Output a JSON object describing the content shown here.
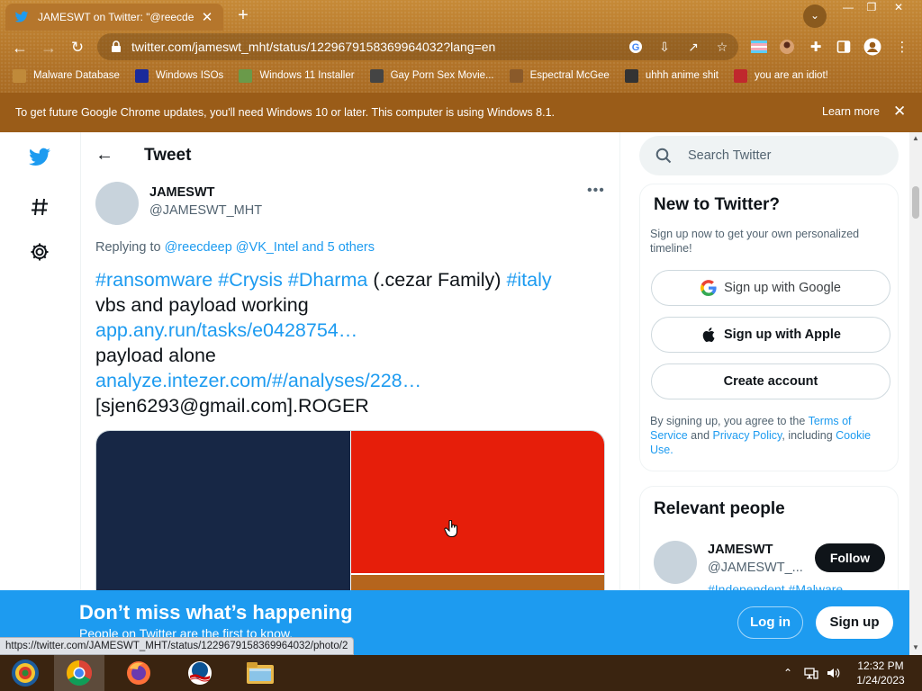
{
  "browser": {
    "tab_title": "JAMESWT on Twitter: \"@reecde",
    "new_tab": "+",
    "tab_search": "⌄",
    "window_controls": {
      "minimize": "—",
      "restore": "❐",
      "close": "✕"
    },
    "url": "twitter.com/jameswt_mht/status/1229679158369964032?lang=en",
    "bookmarks": [
      {
        "label": "Malware Database",
        "color": "#c08a3a"
      },
      {
        "label": "Windows ISOs",
        "color": "#1a2a9a"
      },
      {
        "label": "Windows 11 Installer",
        "color": "#6a9a4a"
      },
      {
        "label": "Gay Porn Sex Movie...",
        "color": "#444444"
      },
      {
        "label": "Espectral McGee",
        "color": "#8a5a2a"
      },
      {
        "label": "uhhh anime shit",
        "color": "#333333"
      },
      {
        "label": "you are an idiot!",
        "color": "#c0282d"
      }
    ]
  },
  "infobar": {
    "message": "To get future Google Chrome updates, you'll need Windows 10 or later. This computer is using Windows 8.1.",
    "learn_more": "Learn more",
    "close": "✕"
  },
  "tweet": {
    "header_title": "Tweet",
    "back": "←",
    "author_name": "JAMESWT",
    "author_handle": "@JAMESWT_MHT",
    "more": "•••",
    "replying_prefix": "Replying to ",
    "replying_to_1": "@reecdeep",
    "replying_to_2": "@VK_Intel",
    "replying_others": "and 5 others",
    "hashtag_ransomware": "#ransomware",
    "hashtag_crysis": "#Crysis",
    "hashtag_dharma": "#Dharma",
    "family_text": "(.cezar Family)",
    "hashtag_italy": "#italy",
    "line_2": "vbs and payload working",
    "link_1": "app.any.run/tasks/e0428754…",
    "line_4": "payload alone",
    "link_2": "analyze.intezer.com/#/analyses/228…",
    "line_6": "[sjen6293@gmail.com].ROGER"
  },
  "sidebar": {
    "search_placeholder": "Search Twitter",
    "new_to_twitter": "New to Twitter?",
    "signup_sub": "Sign up now to get your own personalized timeline!",
    "signup_google": "Sign up with Google",
    "signup_apple": "Sign up with Apple",
    "create_account": "Create account",
    "terms_prefix": "By signing up, you agree to the ",
    "terms_link": "Terms of Service",
    "terms_and": " and ",
    "privacy_link": "Privacy Policy",
    "terms_including": ", including ",
    "cookie_link": "Cookie Use.",
    "relevant_people": "Relevant people",
    "person_name": "JAMESWT",
    "person_handle": "@JAMESWT_...",
    "person_tags": "#Independent #Malware",
    "follow": "Follow"
  },
  "bottom_bar": {
    "headline": "Don’t miss what’s happening",
    "sub": "People on Twitter are the first to know.",
    "login": "Log in",
    "signup": "Sign up"
  },
  "status_url": "https://twitter.com/JAMESWT_MHT/status/1229679158369964032/photo/2",
  "taskbar": {
    "time": "12:32 PM",
    "date": "1/24/2023"
  },
  "colors": {
    "twitter_blue": "#1d9bf0",
    "chrome_frame": "#b87a2c",
    "infobar": "#9a5c18"
  }
}
